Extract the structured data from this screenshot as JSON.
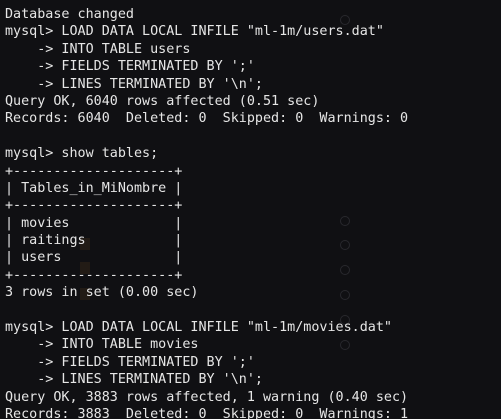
{
  "terminal": {
    "lines": [
      "Database changed",
      "mysql> LOAD DATA LOCAL INFILE \"ml-1m/users.dat\"",
      "    -> INTO TABLE users",
      "    -> FIELDS TERMINATED BY ';'",
      "    -> LINES TERMINATED BY '\\n';",
      "Query OK, 6040 rows affected (0.51 sec)",
      "Records: 6040  Deleted: 0  Skipped: 0  Warnings: 0",
      "",
      "mysql> show tables;",
      "+--------------------+",
      "| Tables_in_MiNombre |",
      "+--------------------+",
      "| movies             |",
      "| raitings           |",
      "| users              |",
      "+--------------------+",
      "3 rows in set (0.00 sec)",
      "",
      "mysql> LOAD DATA LOCAL INFILE \"ml-1m/movies.dat\"",
      "    -> INTO TABLE movies",
      "    -> FIELDS TERMINATED BY ';'",
      "    -> LINES TERMINATED BY '\\n';",
      "Query OK, 3883 rows affected, 1 warning (0.40 sec)",
      "Records: 3883  Deleted: 0  Skipped: 0  Warnings: 1"
    ]
  },
  "background_ghost_text": [
    "",
    "",
    ""
  ]
}
